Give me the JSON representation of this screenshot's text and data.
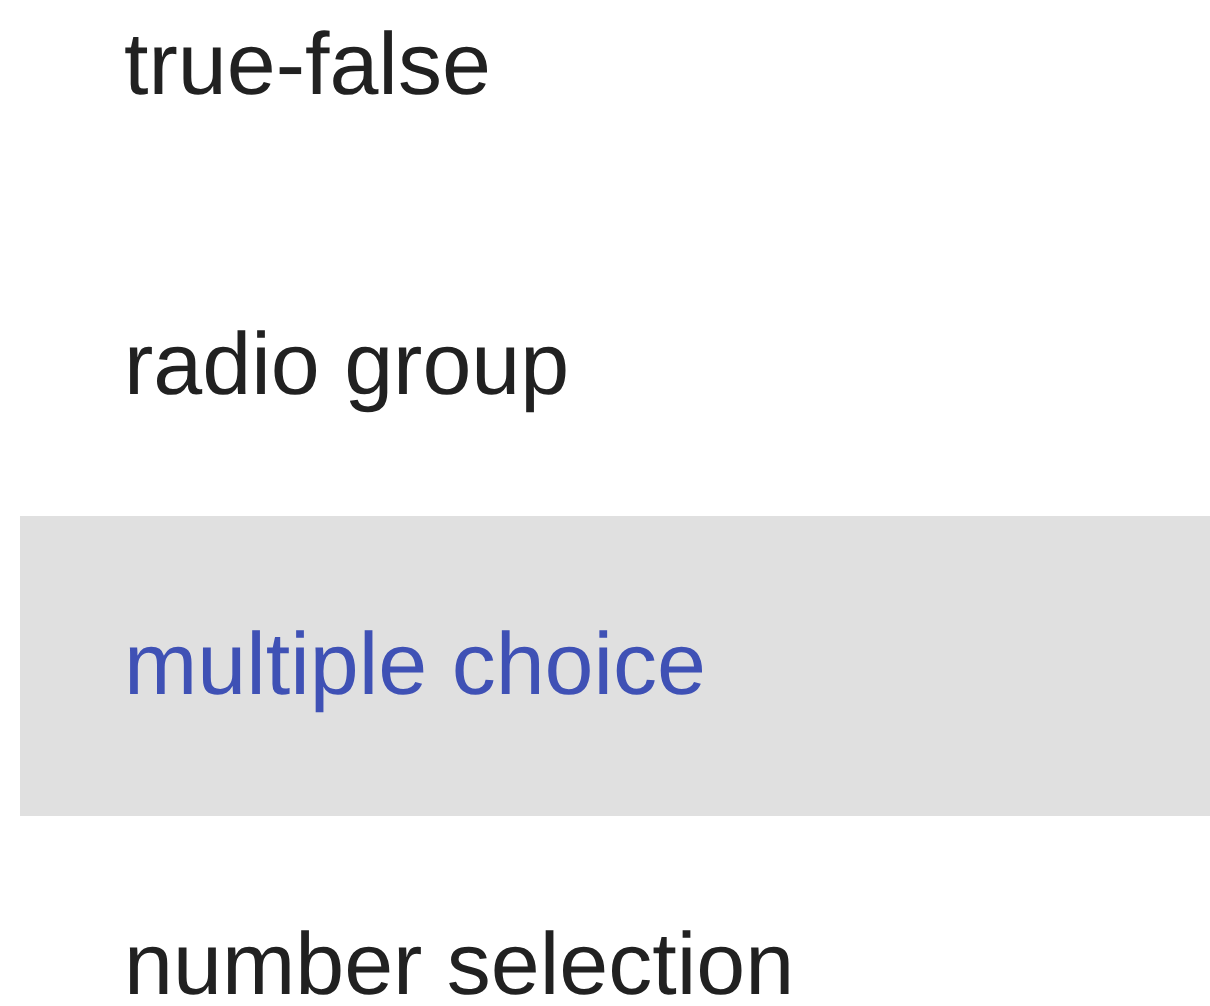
{
  "items": [
    {
      "label": "true-false",
      "selected": false
    },
    {
      "label": "radio group",
      "selected": false
    },
    {
      "label": "multiple choice",
      "selected": true
    },
    {
      "label": "number selection",
      "selected": false
    }
  ]
}
